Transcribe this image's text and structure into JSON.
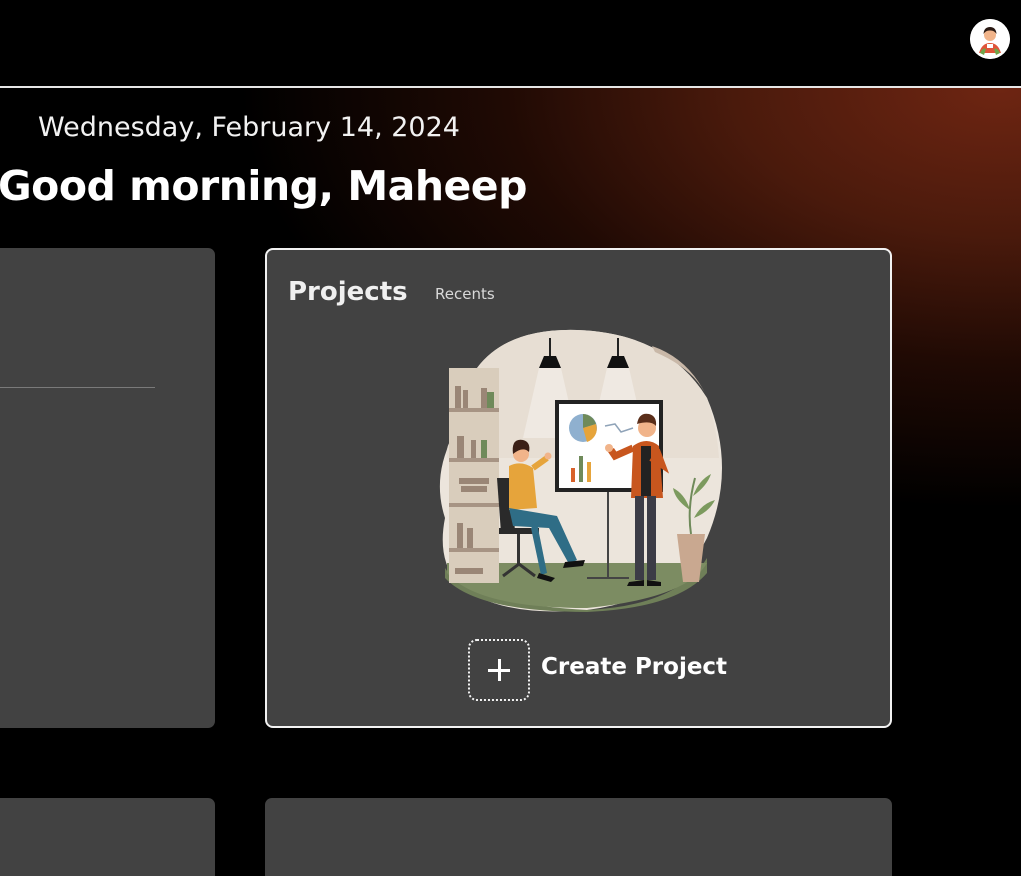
{
  "header": {
    "avatar_alt": "User avatar"
  },
  "main": {
    "date": "Wednesday, February 14, 2024",
    "greeting": "Good morning, Maheep"
  },
  "projects": {
    "title": "Projects",
    "recents_label": "Recents",
    "create_label": "Create Project"
  },
  "colors": {
    "background": "#000000",
    "card": "#424242",
    "accent_gradient": "#6e2512"
  },
  "icons": {
    "avatar": "person-avatar-icon",
    "create": "plus-icon"
  }
}
